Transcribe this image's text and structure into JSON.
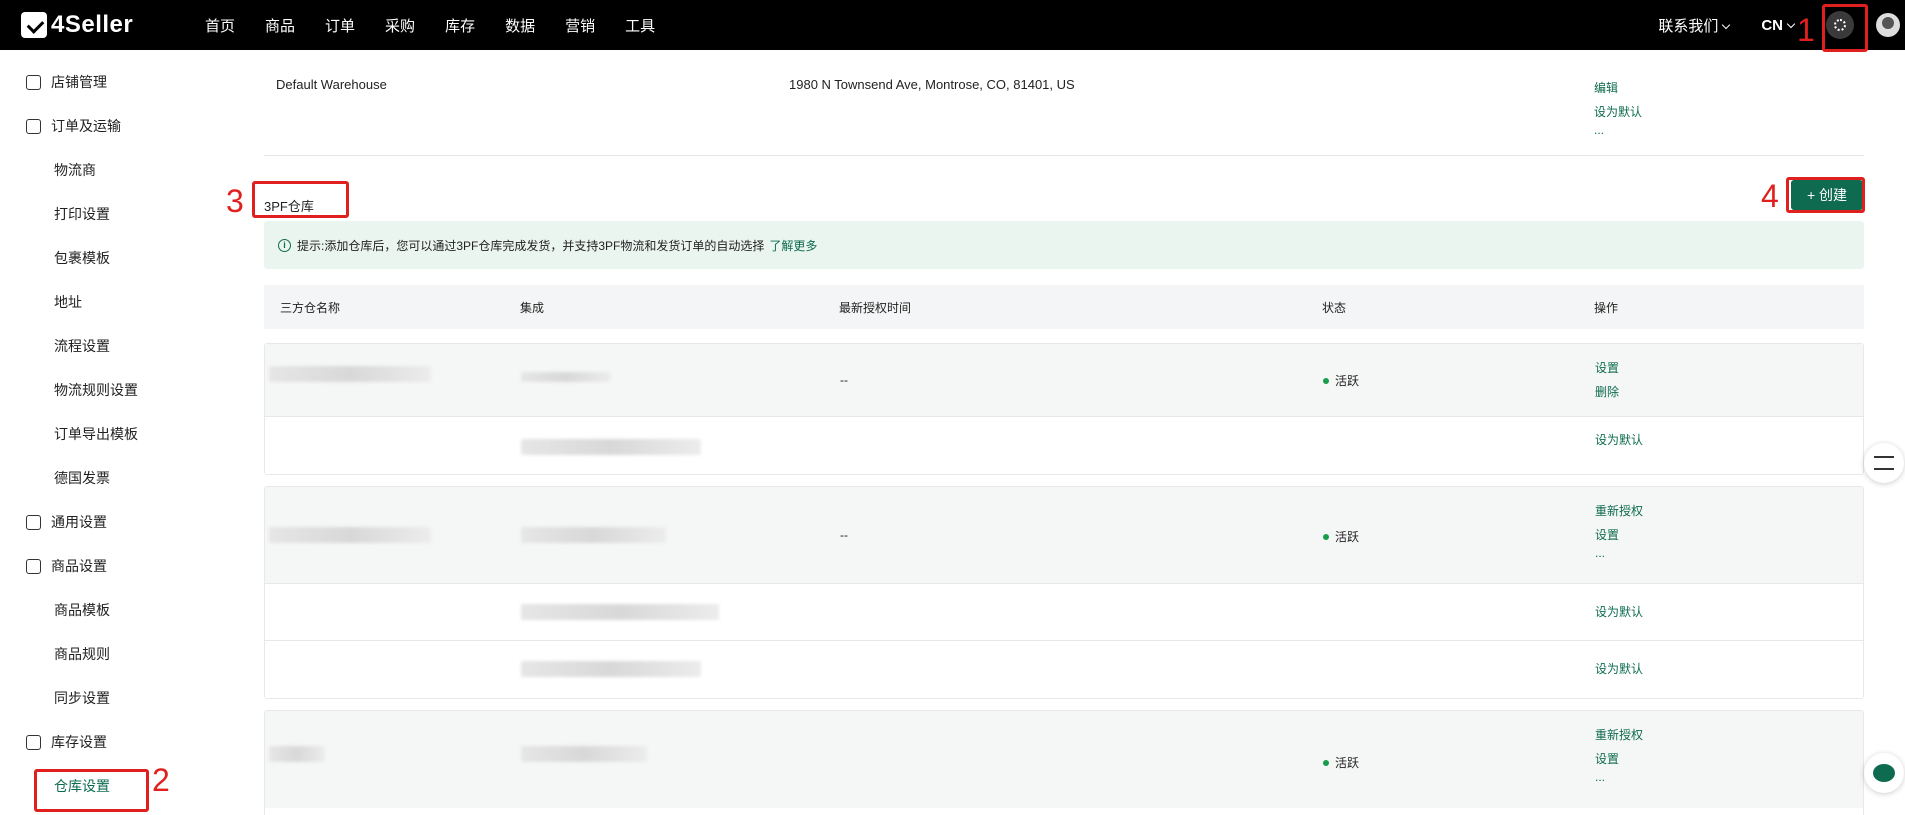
{
  "header": {
    "logo": "4Seller",
    "nav": [
      "首页",
      "商品",
      "订单",
      "采购",
      "库存",
      "数据",
      "营销",
      "工具"
    ],
    "contact": "联系我们",
    "lang": "CN"
  },
  "sidebar": {
    "items": [
      {
        "label": "店铺管理",
        "type": "group"
      },
      {
        "label": "订单及运输",
        "type": "group"
      },
      {
        "label": "物流商",
        "type": "item"
      },
      {
        "label": "打印设置",
        "type": "item"
      },
      {
        "label": "包裹模板",
        "type": "item"
      },
      {
        "label": "地址",
        "type": "item"
      },
      {
        "label": "流程设置",
        "type": "item"
      },
      {
        "label": "物流规则设置",
        "type": "item"
      },
      {
        "label": "订单导出模板",
        "type": "item"
      },
      {
        "label": "德国发票",
        "type": "item"
      },
      {
        "label": "通用设置",
        "type": "group"
      },
      {
        "label": "商品设置",
        "type": "group"
      },
      {
        "label": "商品模板",
        "type": "item"
      },
      {
        "label": "商品规则",
        "type": "item"
      },
      {
        "label": "同步设置",
        "type": "item"
      },
      {
        "label": "库存设置",
        "type": "group"
      },
      {
        "label": "仓库设置",
        "type": "item",
        "active": true
      }
    ]
  },
  "default_warehouse": {
    "name": "Default Warehouse",
    "address": "1980 N Townsend Ave, Montrose, CO, 81401, US",
    "ops": [
      "编辑",
      "设为默认",
      "..."
    ]
  },
  "section": {
    "title": "3PF仓库",
    "create": "+ 创建",
    "tip": "提示:添加仓库后，您可以通过3PF仓库完成发货，并支持3PF物流和发货订单的自动选择",
    "tip_link": "了解更多"
  },
  "table": {
    "headers": [
      "三方仓名称",
      "集成",
      "最新授权时间",
      "状态",
      "操作"
    ],
    "groups": [
      {
        "auth_time": "--",
        "status": "活跃",
        "ops": [
          "设置",
          "删除"
        ],
        "sub_ops": [
          "设为默认"
        ]
      },
      {
        "auth_time": "--",
        "status": "活跃",
        "ops": [
          "重新授权",
          "设置",
          "..."
        ],
        "sub_ops": [
          "设为默认",
          "设为默认"
        ]
      },
      {
        "status": "活跃",
        "ops": [
          "重新授权",
          "设置",
          "..."
        ]
      }
    ]
  },
  "annotations": [
    "1",
    "2",
    "3",
    "4"
  ],
  "colors": {
    "accent": "#0e6b4f",
    "annotation": "#e0201e",
    "active": "#1a9d4b"
  }
}
